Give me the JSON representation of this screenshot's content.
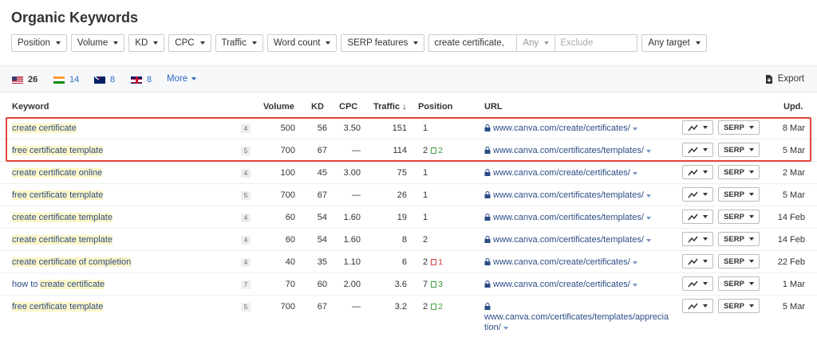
{
  "page_title": "Organic Keywords",
  "filters": {
    "position": "Position",
    "volume": "Volume",
    "kd": "KD",
    "cpc": "CPC",
    "traffic": "Traffic",
    "word_count": "Word count",
    "serp_features": "SERP features",
    "search_value": "create certificate,",
    "search_mode": "Any",
    "exclude_placeholder": "Exclude",
    "target": "Any target"
  },
  "countries": [
    {
      "flag": "us-flag",
      "count": "26"
    },
    {
      "flag": "india-flag",
      "count": "14"
    },
    {
      "flag": "australia-flag",
      "count": "8"
    },
    {
      "flag": "uk-flag",
      "count": "8"
    }
  ],
  "more_label": "More",
  "export_label": "Export",
  "columns": {
    "keyword": "Keyword",
    "volume": "Volume",
    "kd": "KD",
    "cpc": "CPC",
    "traffic": "Traffic",
    "traffic_sort": "↓",
    "position": "Position",
    "url": "URL",
    "updated": "Upd."
  },
  "rows": [
    {
      "kw_hl": "create certificate",
      "kw_rest": "",
      "serp": "4",
      "volume": "500",
      "kd": "56",
      "cpc": "3.50",
      "traffic": "151",
      "position": "1",
      "change": "",
      "url": "www.canva.com/create/certificates/",
      "url2": "",
      "updated": "8 Mar"
    },
    {
      "kw_hl": "free certificate template",
      "kw_rest": "",
      "serp": "5",
      "volume": "700",
      "kd": "67",
      "cpc": "—",
      "traffic": "114",
      "position": "2",
      "change": "2",
      "url": "www.canva.com/certificates/templates/",
      "url2": "",
      "updated": "5 Mar"
    },
    {
      "kw_hl": "create certificate",
      "kw_rest": " online",
      "serp": "4",
      "volume": "100",
      "kd": "45",
      "cpc": "3.00",
      "traffic": "75",
      "position": "1",
      "change": "",
      "url": "www.canva.com/create/certificates/",
      "url2": "",
      "updated": "2 Mar"
    },
    {
      "kw_hl": "free certificate template",
      "kw_rest": "",
      "serp": "5",
      "volume": "700",
      "kd": "67",
      "cpc": "—",
      "traffic": "26",
      "position": "1",
      "change": "",
      "url": "www.canva.com/certificates/templates/",
      "url2": "",
      "updated": "5 Mar"
    },
    {
      "kw_hl": "create certificate",
      "kw_rest": " template",
      "serp": "4",
      "volume": "60",
      "kd": "54",
      "cpc": "1.60",
      "traffic": "19",
      "position": "1",
      "change": "",
      "url": "www.canva.com/certificates/templates/",
      "url2": "",
      "updated": "14 Feb"
    },
    {
      "kw_hl": "create certificate",
      "kw_rest": " template",
      "serp": "4",
      "volume": "60",
      "kd": "54",
      "cpc": "1.60",
      "traffic": "8",
      "position": "2",
      "change": "",
      "url": "www.canva.com/certificates/templates/",
      "url2": "",
      "updated": "14 Feb"
    },
    {
      "kw_hl": "create certificate",
      "kw_rest": " of completion",
      "serp": "4",
      "volume": "40",
      "kd": "35",
      "cpc": "1.10",
      "traffic": "6",
      "position": "2",
      "change": "1",
      "change_dir": "down",
      "url": "www.canva.com/create/certificates/",
      "url2": "",
      "updated": "22 Feb"
    },
    {
      "kw_pre": "how to ",
      "kw_hl": "create certificate",
      "kw_rest": "",
      "serp": "7",
      "volume": "70",
      "kd": "60",
      "cpc": "2.00",
      "traffic": "3.6",
      "position": "7",
      "change": "3",
      "url": "www.canva.com/create/certificates/",
      "url2": "",
      "updated": "1 Mar"
    },
    {
      "kw_hl": "free certificate template",
      "kw_rest": "",
      "serp": "5",
      "volume": "700",
      "kd": "67",
      "cpc": "—",
      "traffic": "3.2",
      "position": "2",
      "change": "2",
      "url": "",
      "url2": "www.canva.com/certificates/templates/apprecia",
      "url3": "tion/",
      "updated": "5 Mar"
    }
  ],
  "row_controls": {
    "serp_label": "SERP"
  },
  "colors": {
    "accent_link": "#2b4d86",
    "highlight": "#fdf6c8",
    "selection_border": "#e0453a",
    "rank_up": "#3a9a3a",
    "rank_down": "#cc3b3b"
  }
}
